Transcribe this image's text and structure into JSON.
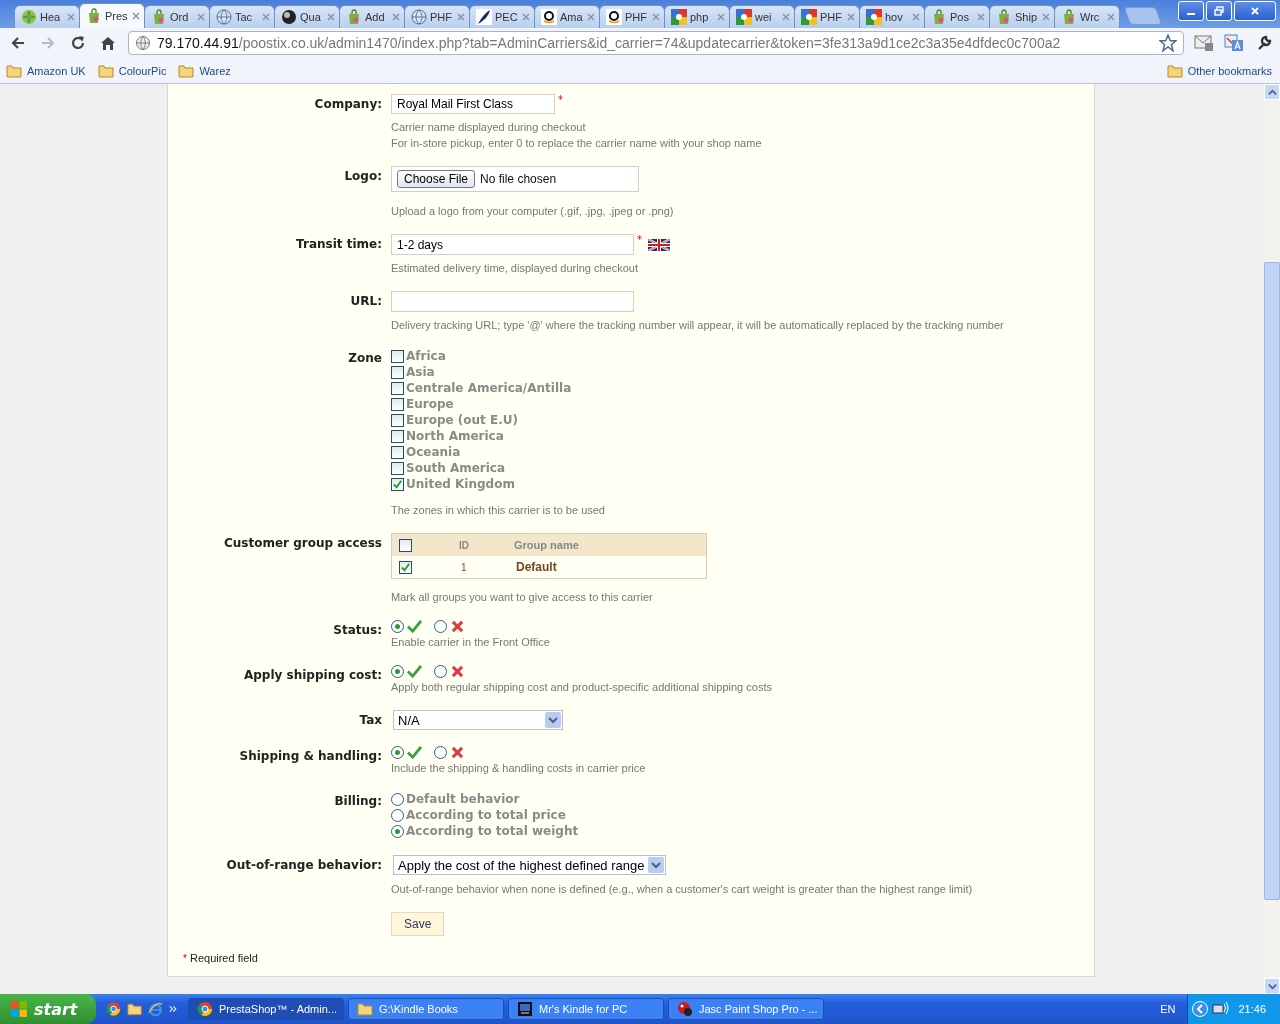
{
  "browser": {
    "tabs": [
      {
        "title": "Hea",
        "selected": false
      },
      {
        "title": "Pres",
        "selected": true
      },
      {
        "title": "Ord",
        "selected": false
      },
      {
        "title": "Tac",
        "selected": false
      },
      {
        "title": "Qua",
        "selected": false
      },
      {
        "title": "Add",
        "selected": false
      },
      {
        "title": "PHF",
        "selected": false
      },
      {
        "title": "PEC",
        "selected": false
      },
      {
        "title": "Ama",
        "selected": false
      },
      {
        "title": "PHF",
        "selected": false
      },
      {
        "title": "php",
        "selected": false
      },
      {
        "title": "wei",
        "selected": false
      },
      {
        "title": "PHF",
        "selected": false
      },
      {
        "title": "hov",
        "selected": false
      },
      {
        "title": "Pos",
        "selected": false
      },
      {
        "title": "Ship",
        "selected": false
      },
      {
        "title": "Wrc",
        "selected": false
      }
    ],
    "address": {
      "host": "79.170.44.91",
      "path": "/poostix.co.uk/admin1470/index.php?tab=AdminCarriers&id_carrier=74&updatecarrier&token=3fe313a9d1ce2c3a35e4dfdec0c700a2"
    },
    "bookmarks": [
      "Amazon UK",
      "ColourPic",
      "Warez"
    ],
    "other_bookmarks": "Other bookmarks"
  },
  "form": {
    "fields": [
      {
        "kind": "text",
        "label": "Company:",
        "value": "Royal Mail First Class",
        "required": true,
        "hints": [
          "Carrier name displayed during checkout",
          "For in-store pickup, enter 0 to replace the carrier name with your shop name"
        ]
      },
      {
        "kind": "file",
        "label": "Logo:",
        "button": "Choose File",
        "status": "No file chosen",
        "hints": [
          "Upload a logo from your computer (.gif, .jpg, .jpeg or .png)"
        ]
      },
      {
        "kind": "text",
        "label": "Transit time:",
        "value": "1-2 days",
        "required": true,
        "flag": true,
        "hints": [
          "Estimated delivery time, displayed during checkout"
        ]
      },
      {
        "kind": "text",
        "label": "URL:",
        "hints": [
          "Delivery tracking URL; type '@' where the tracking number will appear, it will be automatically replaced by the tracking number"
        ]
      },
      {
        "kind": "checklist",
        "label": "Zone",
        "options": [
          {
            "label": "Africa",
            "checked": false
          },
          {
            "label": "Asia",
            "checked": false
          },
          {
            "label": "Centrale America/Antilla",
            "checked": false
          },
          {
            "label": "Europe",
            "checked": false
          },
          {
            "label": "Europe (out E.U)",
            "checked": false
          },
          {
            "label": "North America",
            "checked": false
          },
          {
            "label": "Oceania",
            "checked": false
          },
          {
            "label": "South America",
            "checked": false
          },
          {
            "label": "United Kingdom",
            "checked": true
          }
        ],
        "hints": [
          "The zones in which this carrier is to be used"
        ]
      },
      {
        "kind": "groups",
        "label": "Customer group access",
        "all_checked": false,
        "columns": [
          "ID",
          "Group name"
        ],
        "rows": [
          {
            "checked": true,
            "id": "1",
            "name": "Default"
          }
        ],
        "hints": [
          "Mark all groups you want to give access to this carrier"
        ]
      },
      {
        "kind": "toggle",
        "label": "Status:",
        "enabled": true,
        "hints": [
          "Enable carrier in the Front Office"
        ]
      },
      {
        "kind": "toggle",
        "label": "Apply shipping cost:",
        "enabled": true,
        "hints": [
          "Apply both regular shipping cost and product-specific additional shipping costs"
        ]
      },
      {
        "kind": "select",
        "label": "Tax",
        "value": "N/A"
      },
      {
        "kind": "toggle",
        "label": "Shipping & handling:",
        "enabled": true,
        "hints": [
          "Include the shipping & handling costs in carrier price"
        ]
      },
      {
        "kind": "radios",
        "label": "Billing:",
        "options": [
          {
            "label": "Default behavior",
            "selected": false
          },
          {
            "label": "According to total price",
            "selected": false
          },
          {
            "label": "According to total weight",
            "selected": true
          }
        ]
      },
      {
        "kind": "select",
        "label": "Out-of-range behavior:",
        "value": "Apply the cost of the highest defined range",
        "hints": [
          "Out-of-range behavior when none is defined (e.g., when a customer's cart weight is greater than the highest range limit)"
        ]
      }
    ],
    "save": "Save",
    "required_note": {
      "mark": "*",
      "text": "Required field"
    }
  },
  "taskbar": {
    "start": "start",
    "windows": [
      {
        "title": "PrestaShop™ - Admin...",
        "selected": true
      },
      {
        "title": "G:\\Kindle Books",
        "selected": false
      },
      {
        "title": "Mr's Kindle for PC",
        "selected": false
      },
      {
        "title": "Jasc Paint Shop Pro - ...",
        "selected": false
      }
    ],
    "language": "EN",
    "clock": "21:46"
  }
}
